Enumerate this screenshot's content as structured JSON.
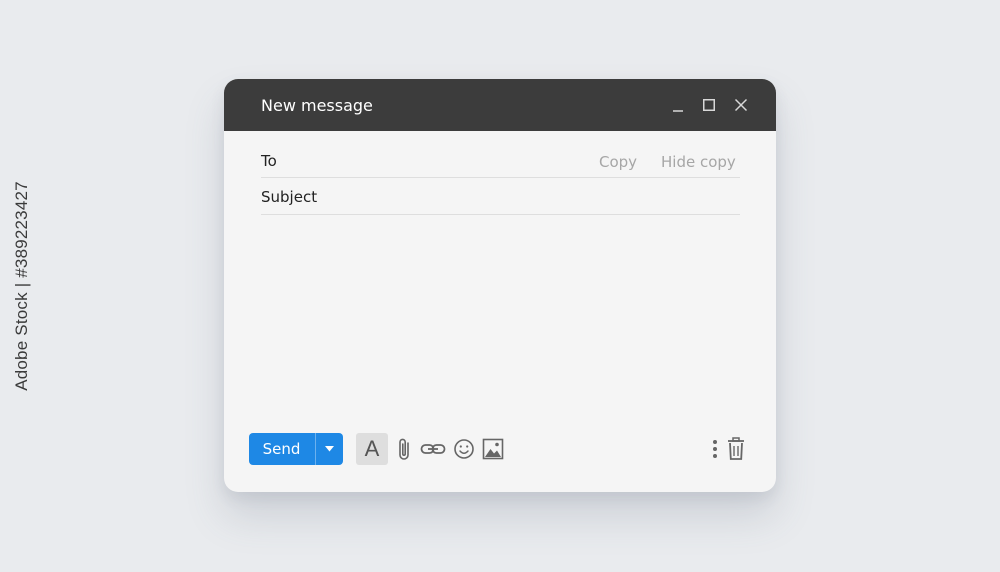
{
  "watermark": {
    "side_text": "Adobe Stock | #389223427"
  },
  "window": {
    "title": "New message",
    "controls": [
      "minimize-icon",
      "maximize-icon",
      "close-icon"
    ]
  },
  "fields": {
    "to_label": "To",
    "to_value": "",
    "copy_label": "Copy",
    "hide_copy_label": "Hide copy",
    "subject_label": "Subject",
    "subject_value": ""
  },
  "body": {
    "value": ""
  },
  "toolbar": {
    "send_label": "Send",
    "format_glyph": "A",
    "icons": [
      "caret-down-icon",
      "text-format-icon",
      "paperclip-icon",
      "link-icon",
      "emoji-icon",
      "image-icon",
      "more-vertical-icon",
      "trash-icon"
    ]
  },
  "colors": {
    "titlebar": "#3c3c3c",
    "window_bg": "#f5f5f5",
    "page_bg": "#e9ebee",
    "accent": "#1e88e5",
    "muted_text": "#a6a6a6",
    "icon": "#666666"
  }
}
